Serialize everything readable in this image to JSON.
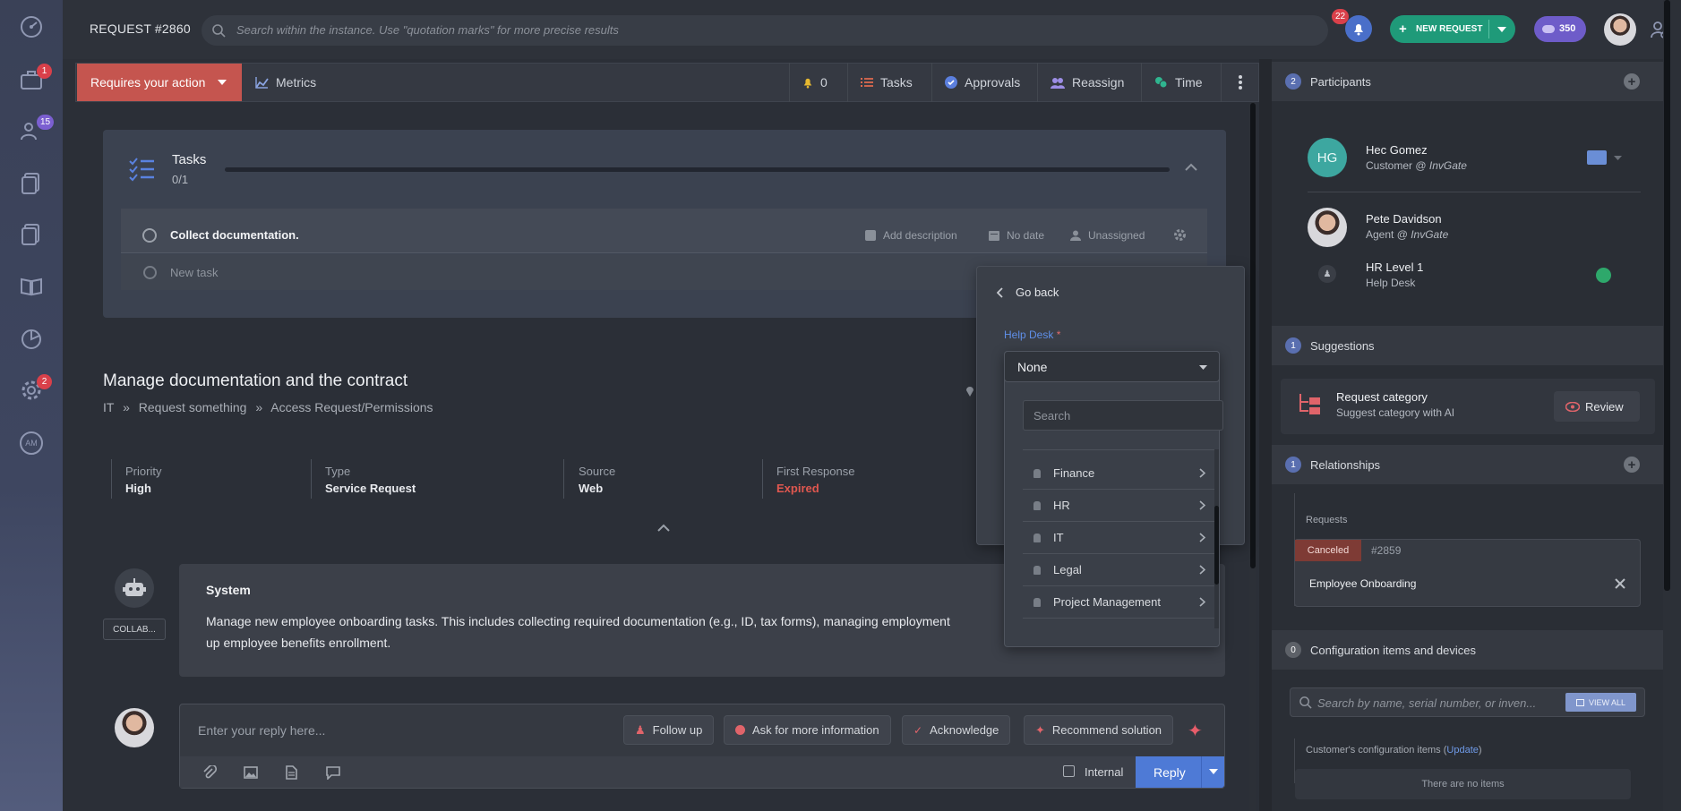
{
  "header": {
    "request_id": "REQUEST #2860",
    "search_placeholder": "Search within the instance. Use \"quotation marks\" for more precise results",
    "notifications_count": "22",
    "new_request_label": "NEW REQUEST",
    "credits": "350"
  },
  "sidebar": {
    "badges": {
      "requests": "1",
      "users": "15",
      "settings": "2"
    },
    "am_label": "AM"
  },
  "toolbar": {
    "requires_action": "Requires your action",
    "metrics": "Metrics",
    "alerts_count": "0",
    "tasks": "Tasks",
    "approvals": "Approvals",
    "reassign": "Reassign",
    "time": "Time"
  },
  "tasks": {
    "title": "Tasks",
    "progress": "0/1",
    "progress_fraction": 0,
    "items": [
      {
        "name": "Collect documentation.",
        "add_description": "Add description",
        "date": "No date",
        "assignee": "Unassigned"
      }
    ],
    "new_task_placeholder": "New task"
  },
  "request": {
    "title": "Manage documentation and the contract",
    "breadcrumb": [
      "IT",
      "Request something",
      "Access Request/Permissions"
    ],
    "breadcrumb_sep": "»",
    "meta": [
      {
        "label": "Priority",
        "value": "High",
        "color": "#e8eaee"
      },
      {
        "label": "Type",
        "value": "Service Request",
        "color": "#e8eaee"
      },
      {
        "label": "Source",
        "value": "Web",
        "color": "#e8eaee"
      },
      {
        "label": "First Response",
        "value": "Expired",
        "color": "#e0574f"
      }
    ]
  },
  "system_message": {
    "author": "System",
    "tag": "COLLAB...",
    "line1": "Manage new employee onboarding tasks. This includes collecting required documentation (e.g., ID, tax forms), managing employment",
    "line2": "up employee benefits enrollment."
  },
  "reply": {
    "placeholder": "Enter your reply here...",
    "quick_actions": [
      "Follow up",
      "Ask for more information",
      "Acknowledge",
      "Recommend solution"
    ],
    "internal_label": "Internal",
    "reply_label": "Reply"
  },
  "popover": {
    "go_back": "Go back",
    "field_label": "Help Desk",
    "required_mark": "*",
    "selected": "None",
    "search_placeholder": "Search",
    "options": [
      "Finance",
      "HR",
      "IT",
      "Legal",
      "Project Management"
    ]
  },
  "participants": {
    "count": "2",
    "title": "Participants",
    "people": [
      {
        "initials": "HG",
        "name": "Hec Gomez",
        "role": "Customer @ ",
        "org": "InvGate"
      },
      {
        "name": "Pete Davidson",
        "role": "Agent @ ",
        "org": "InvGate"
      },
      {
        "name": "HR Level 1",
        "role": "Help Desk"
      }
    ]
  },
  "suggestions": {
    "count": "1",
    "title": "Suggestions",
    "item_title": "Request category",
    "item_sub": "Suggest category with AI",
    "review_label": "Review"
  },
  "relationships": {
    "count": "1",
    "title": "Relationships",
    "group_label": "Requests",
    "status": "Canceled",
    "related_id": "#2859",
    "related_title": "Employee Onboarding"
  },
  "config_items": {
    "count": "0",
    "title": "Configuration items and devices",
    "search_placeholder": "Search by name, serial number, or inven...",
    "view_all": "VIEW ALL",
    "customer_label": "Customer's configuration items (",
    "update_link": "Update",
    "customer_label_end": ")",
    "empty": "There are no items"
  }
}
